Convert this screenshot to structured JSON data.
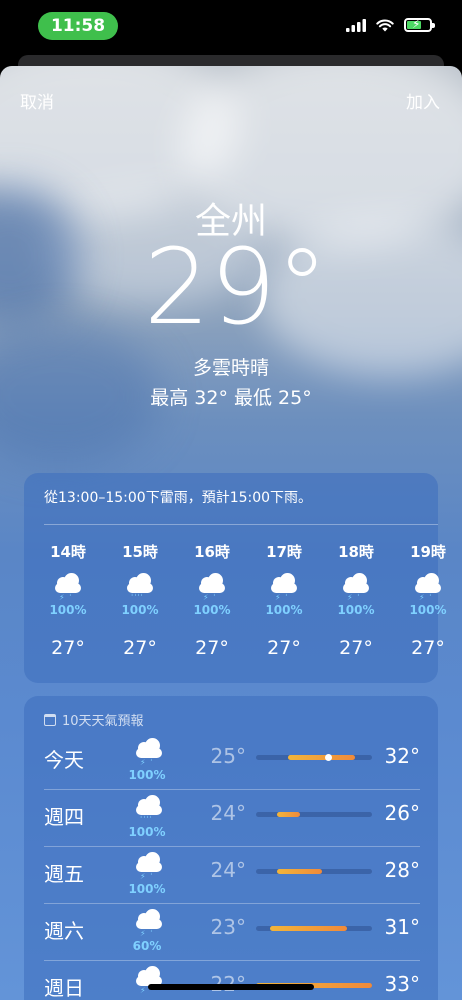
{
  "status": {
    "time": "11:58"
  },
  "nav": {
    "cancel": "取消",
    "add": "加入"
  },
  "current": {
    "city": "全州",
    "temp": "29°",
    "condition": "多雲時晴",
    "hilo": "最高 32°  最低 25°"
  },
  "hourly": {
    "summary": "從13:00–15:00下雷雨，預計15:00下雨。",
    "items": [
      {
        "time": "14時",
        "icon": "thunderstorm-icon",
        "pct": "100%",
        "temp": "27°"
      },
      {
        "time": "15時",
        "icon": "rain-icon",
        "pct": "100%",
        "temp": "27°"
      },
      {
        "time": "16時",
        "icon": "thunderstorm-icon",
        "pct": "100%",
        "temp": "27°"
      },
      {
        "time": "17時",
        "icon": "thunderstorm-icon",
        "pct": "100%",
        "temp": "27°"
      },
      {
        "time": "18時",
        "icon": "thunderstorm-icon",
        "pct": "100%",
        "temp": "27°"
      },
      {
        "time": "19時",
        "icon": "thunderstorm-icon",
        "pct": "100%",
        "temp": "27°"
      }
    ]
  },
  "daily": {
    "title": "10天天氣預報",
    "days": [
      {
        "day": "今天",
        "icon": "thunderstorm-icon",
        "pct": "100%",
        "low": "25°",
        "high": "32°",
        "bar_start": 0.28,
        "bar_end": 0.86,
        "current_marker": 0.62
      },
      {
        "day": "週四",
        "icon": "rain-icon",
        "pct": "100%",
        "low": "24°",
        "high": "26°",
        "bar_start": 0.18,
        "bar_end": 0.38
      },
      {
        "day": "週五",
        "icon": "thunderstorm-icon",
        "pct": "100%",
        "low": "24°",
        "high": "28°",
        "bar_start": 0.18,
        "bar_end": 0.57
      },
      {
        "day": "週六",
        "icon": "thunderstorm-icon",
        "pct": "60%",
        "low": "23°",
        "high": "31°",
        "bar_start": 0.12,
        "bar_end": 0.78
      },
      {
        "day": "週日",
        "icon": "thunderstorm-icon",
        "pct": "",
        "low": "22°",
        "high": "33°",
        "bar_start": 0.0,
        "bar_end": 1.0
      }
    ]
  },
  "colors": {
    "accent_blue": "#7fd0ff",
    "bar_warm": "#f08a3a",
    "time_pill": "#3fbf4c"
  }
}
